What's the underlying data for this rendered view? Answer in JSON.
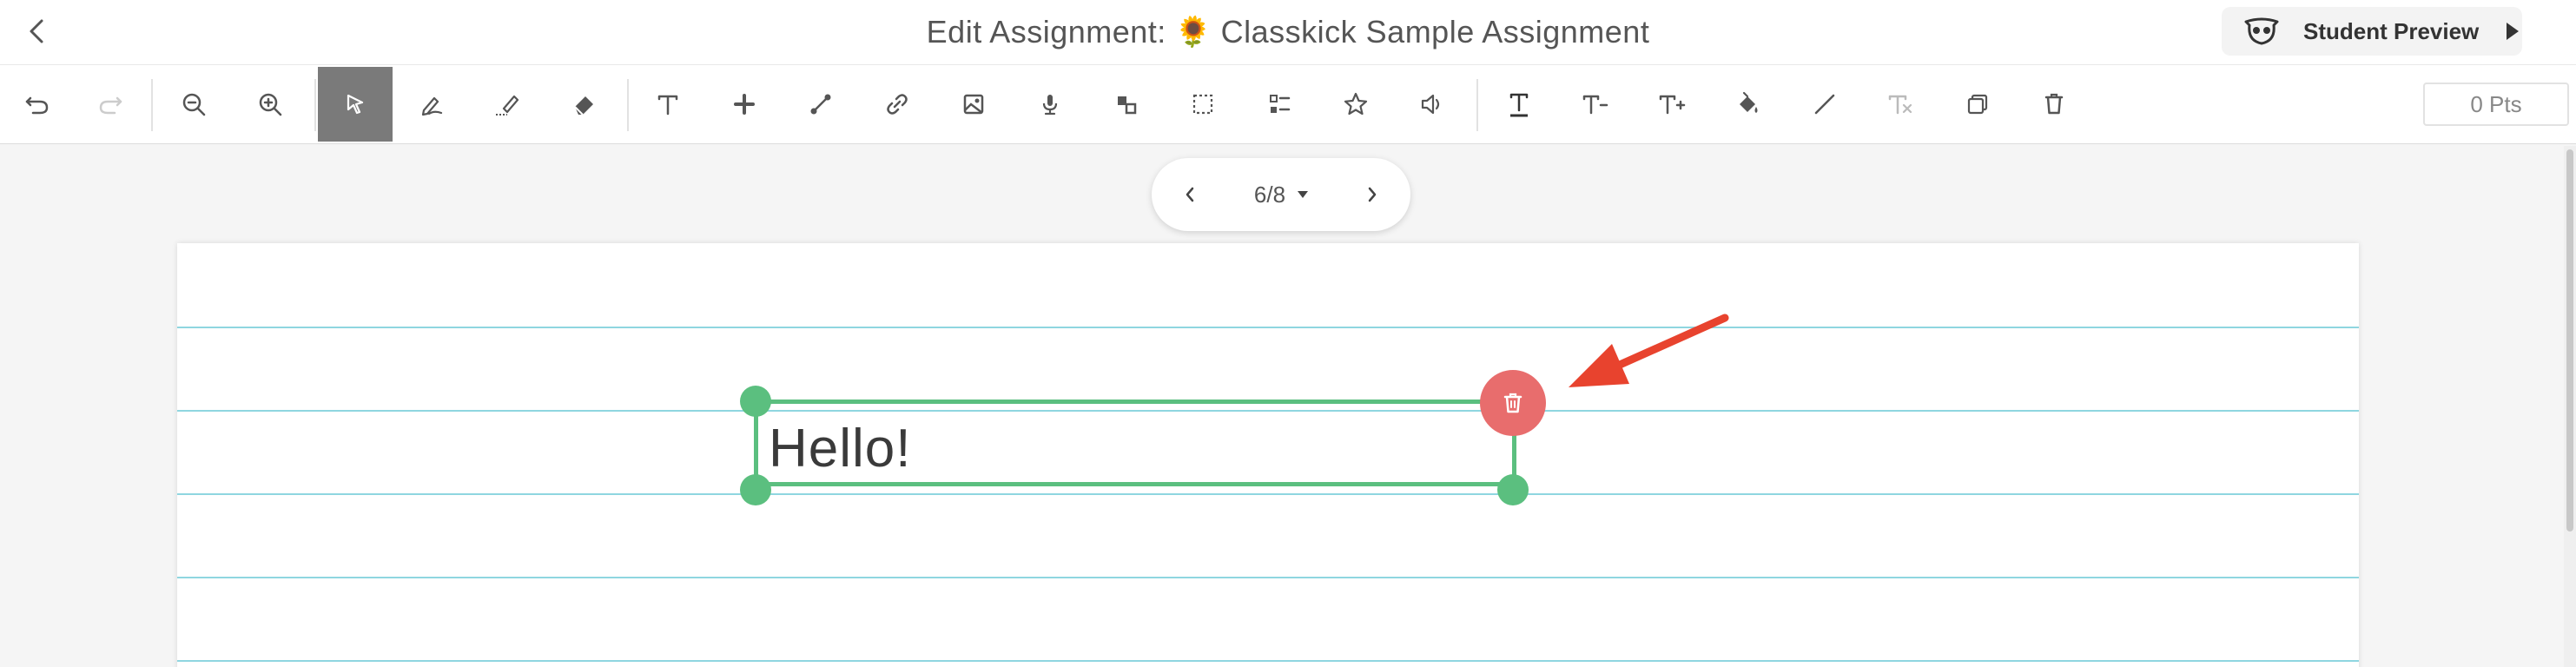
{
  "header": {
    "title_prefix": "Edit Assignment:",
    "title_emoji": "🌻",
    "title_name": "Classkick Sample Assignment",
    "preview_label": "Student Preview"
  },
  "toolbar": {
    "points": "0 Pts",
    "tools": [
      {
        "name": "undo",
        "icon": "undo-icon"
      },
      {
        "name": "redo",
        "icon": "redo-icon",
        "disabled": true
      },
      {
        "name": "zoom-out",
        "icon": "zoom-out-icon"
      },
      {
        "name": "zoom-in",
        "icon": "zoom-in-icon"
      },
      {
        "name": "select",
        "icon": "cursor-icon",
        "active": true
      },
      {
        "name": "pen",
        "icon": "pen-icon"
      },
      {
        "name": "highlighter",
        "icon": "highlighter-icon"
      },
      {
        "name": "eraser",
        "icon": "eraser-icon"
      },
      {
        "name": "text",
        "icon": "text-icon"
      },
      {
        "name": "sticker",
        "icon": "plus-icon"
      },
      {
        "name": "line",
        "icon": "line-connector-icon"
      },
      {
        "name": "link",
        "icon": "link-icon"
      },
      {
        "name": "image",
        "icon": "image-icon"
      },
      {
        "name": "audio-record",
        "icon": "microphone-icon"
      },
      {
        "name": "manipulative",
        "icon": "shapes-icon"
      },
      {
        "name": "selection-box",
        "icon": "dashed-box-icon"
      },
      {
        "name": "multiple-choice",
        "icon": "checklist-icon"
      },
      {
        "name": "star",
        "icon": "star-icon"
      },
      {
        "name": "speaker",
        "icon": "speaker-icon"
      },
      {
        "name": "text-format",
        "icon": "text-underline-icon"
      },
      {
        "name": "text-smaller",
        "icon": "text-minus-icon"
      },
      {
        "name": "text-larger",
        "icon": "text-plus-icon"
      },
      {
        "name": "fill",
        "icon": "paint-bucket-icon"
      },
      {
        "name": "stroke",
        "icon": "diagonal-line-icon"
      },
      {
        "name": "text-clear",
        "icon": "text-clear-icon",
        "disabled": true
      },
      {
        "name": "duplicate",
        "icon": "duplicate-icon"
      },
      {
        "name": "trash",
        "icon": "trash-icon"
      }
    ]
  },
  "pager": {
    "indicator": "6/8"
  },
  "canvas": {
    "textbox_text": "Hello!"
  },
  "colors": {
    "selection": "#5bbf7f",
    "delete": "#e86d6d",
    "rule": "#8fd6e0",
    "annotation_arrow": "#e8432e",
    "active_tool": "#7a7a7a"
  }
}
